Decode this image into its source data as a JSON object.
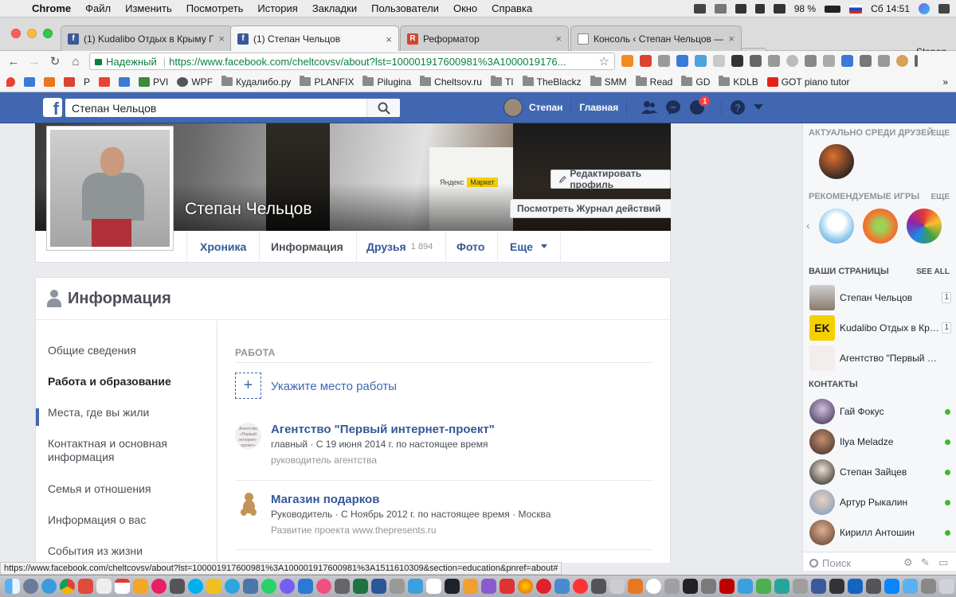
{
  "menubar": {
    "app": "Chrome",
    "items": [
      "Файл",
      "Изменить",
      "Посмотреть",
      "История",
      "Закладки",
      "Пользователи",
      "Окно",
      "Справка"
    ],
    "battery": "98 %",
    "datetime": "Сб 14:51"
  },
  "tabs": [
    {
      "title": "(1) Kudalibo Отдых в Крыму П",
      "icon": "facebook-icon"
    },
    {
      "title": "(1) Степан Чельцов",
      "icon": "facebook-icon",
      "active": true
    },
    {
      "title": "Реформатор",
      "icon": "reformator-icon"
    },
    {
      "title": "Консоль ‹ Степан Чельцов —",
      "icon": "page-icon"
    }
  ],
  "browser_user": "Stepan",
  "address": {
    "secure_label": "Надежный",
    "url": "https://www.facebook.com/cheltcovsv/about?lst=100001917600981%3A1000019176..."
  },
  "bookmarks": [
    "P",
    "PVI",
    "WPF",
    "Кудалибо.ру",
    "PLANFIX",
    "Pilugina",
    "Cheltsov.ru",
    "TI",
    "TheBlackz",
    "SMM",
    "Read",
    "GD",
    "KDLB",
    "GOT piano tutor"
  ],
  "fb": {
    "search_value": "Степан Чельцов",
    "user_name": "Степан",
    "home": "Главная",
    "notif_count": "1"
  },
  "profile": {
    "name": "Степан Чельцов",
    "edit_button": "Редактировать профиль",
    "activity_log_button": "Посмотреть Журнал действий",
    "more_button": "···",
    "cover_sign": "Яндекс",
    "cover_sign_badge": "Маркет",
    "tabs": [
      {
        "label": "Хроника"
      },
      {
        "label": "Информация",
        "active": true
      },
      {
        "label": "Друзья",
        "count": "1 894"
      },
      {
        "label": "Фото"
      },
      {
        "label": "Еще"
      }
    ]
  },
  "about": {
    "title": "Информация",
    "nav": [
      "Общие сведения",
      "Работа и образование",
      "Места, где вы жили",
      "Контактная и основная информация",
      "Семья и отношения",
      "Информация о вас",
      "События из жизни"
    ],
    "active_nav": "Работа и образование",
    "section_title": "РАБОТА",
    "add_work": "Укажите место работы",
    "add_symbol": "+",
    "jobs": [
      {
        "title": "Агентство \"Первый интернет-проект\"",
        "sub": "главный · С 19 июня 2014 г. по настоящее время",
        "desc": "руководитель агентства",
        "logo_text": "Агентство «Первый интернет-проект»"
      },
      {
        "title": "Магазин подарков",
        "sub": "Руководитель · С Ноябрь 2012 г. по настоящее время · Москва",
        "desc": "Развитие проекта www.thepresents.ru"
      }
    ]
  },
  "sidebar": {
    "trending_title": "АКТУАЛЬНО СРЕДИ ДРУЗЕЙ",
    "trending_more": "ЕЩЕ",
    "games_title": "РЕКОМЕНДУЕМЫЕ ИГРЫ",
    "games_more": "ЕЩЕ",
    "pages_title": "ВАШИ СТРАНИЦЫ",
    "pages_more": "SEE ALL",
    "pages": [
      {
        "name": "Степан Чельцов",
        "count": "1"
      },
      {
        "name": "Kudalibo Отдых в Крыму",
        "count": "1"
      },
      {
        "name": "Агентство \"Первый интернет-проект\""
      }
    ],
    "contacts_title": "КОНТАКТЫ",
    "contacts": [
      "Гай Фокус",
      "Ilya Meladze",
      "Степан Зайцев",
      "Артур Рыкалин",
      "Кирилл Антошин"
    ],
    "search_placeholder": "Поиск"
  },
  "status_url": "https://www.facebook.com/cheltcovsv/about?lst=100001917600981%3A100001917600981%3A1511610309&section=education&pnref=about#",
  "colors": {
    "fb_blue": "#4267b2",
    "link": "#365899",
    "online": "#42b72a",
    "badge": "#fa3e3e"
  }
}
